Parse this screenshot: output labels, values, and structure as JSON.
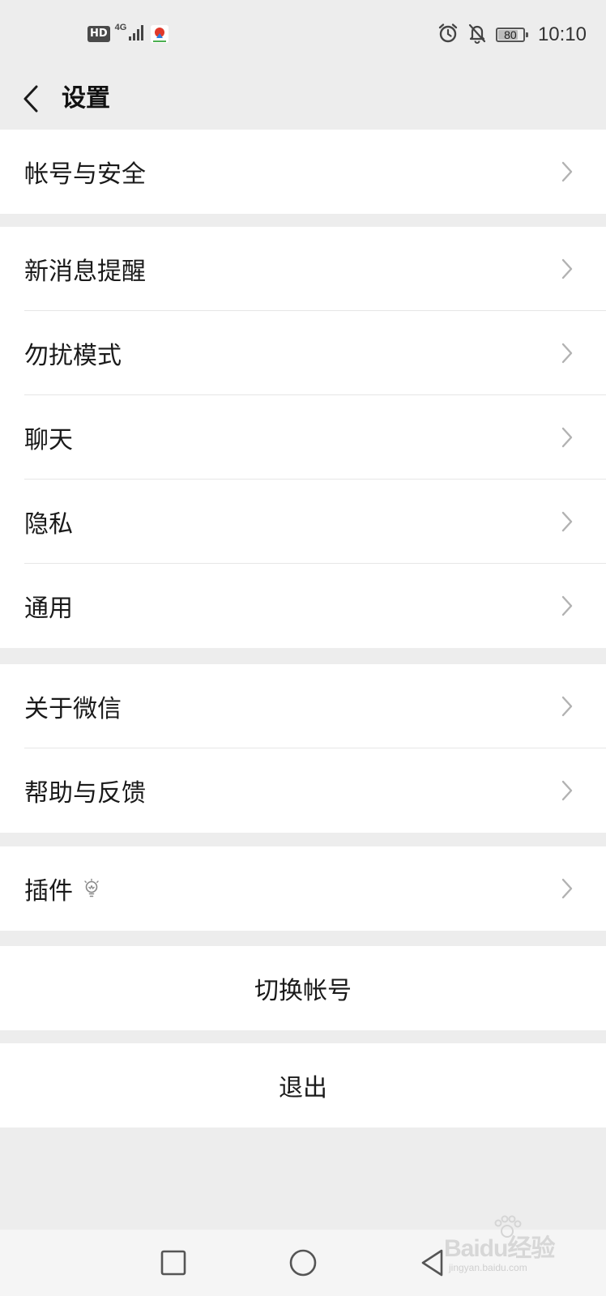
{
  "status_bar": {
    "hd": "HD",
    "network": "4G",
    "battery": 80,
    "battery_text": "80",
    "time": "10:10"
  },
  "header": {
    "title": "设置"
  },
  "groups": [
    {
      "items": [
        {
          "label": "帐号与安全"
        }
      ]
    },
    {
      "items": [
        {
          "label": "新消息提醒"
        },
        {
          "label": "勿扰模式"
        },
        {
          "label": "聊天"
        },
        {
          "label": "隐私"
        },
        {
          "label": "通用"
        }
      ]
    },
    {
      "items": [
        {
          "label": "关于微信"
        },
        {
          "label": "帮助与反馈"
        }
      ]
    },
    {
      "items": [
        {
          "label": "插件",
          "icon": "lightbulb-icon"
        }
      ]
    }
  ],
  "buttons": {
    "switch_account": "切换帐号",
    "logout": "退出"
  },
  "watermark": {
    "logo": "Baidu经验",
    "sub": "jingyan.baidu.com"
  },
  "colors": {
    "background": "#ededed",
    "card": "#ffffff",
    "text": "#1a1a1a",
    "chevron": "#b2b2b2",
    "divider": "#e6e6e6"
  }
}
